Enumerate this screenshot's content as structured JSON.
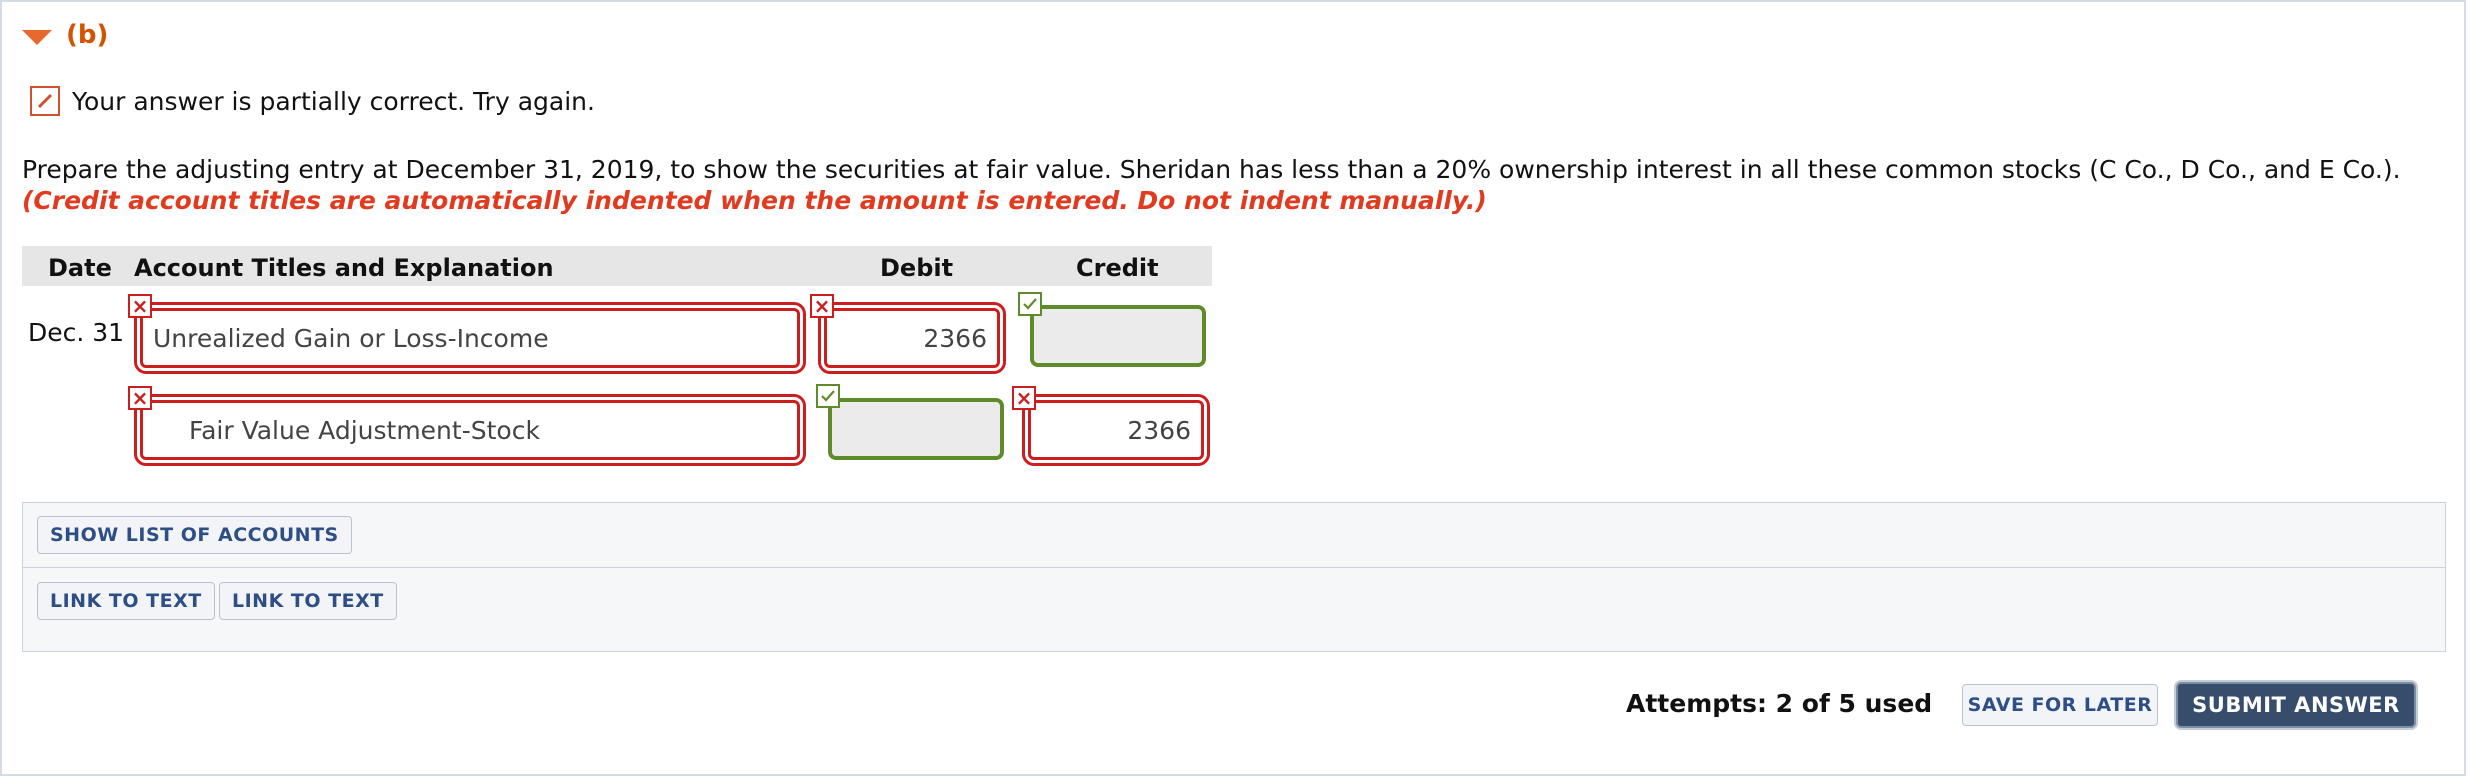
{
  "part": {
    "label": "(b)"
  },
  "feedback": {
    "message": "Your answer is partially correct.  Try again."
  },
  "instructions": {
    "text": "Prepare the adjusting entry at December 31, 2019, to show the securities at fair value. Sheridan has less than a 20% ownership interest in all these common stocks (C Co., D Co., and E Co.).",
    "note": "(Credit account titles are automatically indented when the amount is entered. Do not indent manually.)"
  },
  "journal": {
    "headers": {
      "date": "Date",
      "account": "Account Titles and Explanation",
      "debit": "Debit",
      "credit": "Credit"
    },
    "rows": [
      {
        "date": "Dec. 31",
        "account": "Unrealized Gain or Loss-Income",
        "debit": "2366",
        "credit": ""
      },
      {
        "date": "",
        "account": "Fair Value Adjustment-Stock",
        "debit": "",
        "credit": "2366"
      }
    ]
  },
  "tools": {
    "show_list_label": "SHOW LIST OF ACCOUNTS",
    "link1_label": "LINK TO TEXT",
    "link2_label": "LINK TO TEXT"
  },
  "footer": {
    "attempts": "Attempts: 2 of 5 used",
    "save_label": "SAVE FOR LATER",
    "submit_label": "SUBMIT ANSWER"
  },
  "colors": {
    "error": "#cc1e1e",
    "correct": "#5e8c2a",
    "accent": "#d35400",
    "note": "#e13a1f",
    "submit_bg": "#364d6b"
  }
}
